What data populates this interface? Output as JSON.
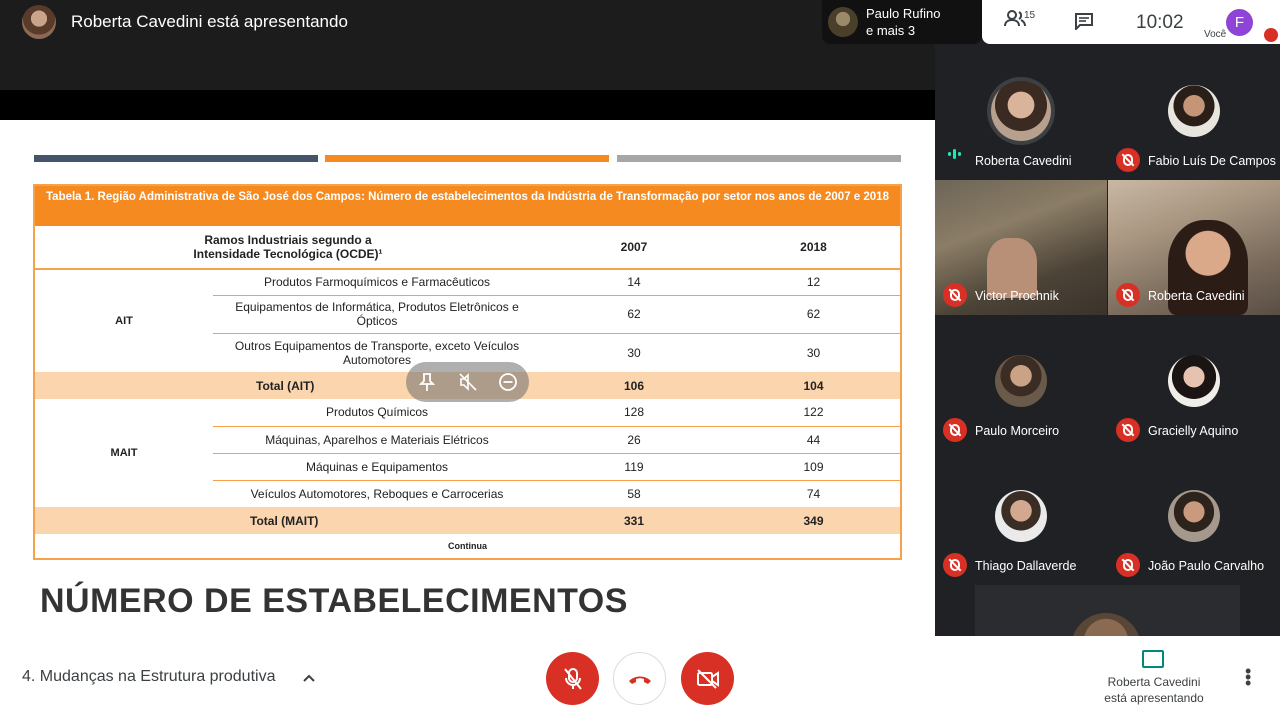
{
  "header": {
    "presenter_title": "Roberta Cavedini está apresentando",
    "extra_participants": {
      "line1": "Paulo Rufino",
      "line2": "e mais 3"
    },
    "people_count": "15",
    "clock": "10:02",
    "self_initial": "F",
    "self_label": "Você"
  },
  "slide": {
    "table_caption": "Tabela 1. Região Administrativa de São José dos Campos: Número de estabelecimentos da Indústria de Transformação por setor nos anos de 2007 e 2018",
    "col_header": "Ramos Industriais segundo a Intensidade Tecnológica (OCDE)¹",
    "year_1": "2007",
    "year_2": "2018",
    "groups": [
      {
        "name": "AIT",
        "rows": [
          {
            "label": "Produtos Farmoquímicos e Farmacêuticos",
            "v2007": "14",
            "v2018": "12"
          },
          {
            "label": "Equipamentos de Informática, Produtos Eletrônicos e Ópticos",
            "v2007": "62",
            "v2018": "62"
          },
          {
            "label": "Outros Equipamentos de Transporte, exceto Veículos Automotores",
            "v2007": "30",
            "v2018": "30"
          }
        ],
        "total": {
          "label": "Total (AIT)",
          "v2007": "106",
          "v2018": "104"
        }
      },
      {
        "name": "MAIT",
        "rows": [
          {
            "label": "Produtos Químicos",
            "v2007": "128",
            "v2018": "122"
          },
          {
            "label": "Máquinas, Aparelhos e Materiais Elétricos",
            "v2007": "26",
            "v2018": "44"
          },
          {
            "label": "Máquinas e Equipamentos",
            "v2007": "119",
            "v2018": "109"
          },
          {
            "label": "Veículos Automotores, Reboques e Carrocerias",
            "v2007": "58",
            "v2018": "74"
          }
        ],
        "total": {
          "label": "Total (MAIT)",
          "v2007": "331",
          "v2018": "349"
        }
      }
    ],
    "footer": "Continua",
    "heading": "NÚMERO DE ESTABELECIMENTOS"
  },
  "participants": [
    {
      "name": "Roberta Cavedini",
      "status": "speaking"
    },
    {
      "name": "Fabio Luís De Campos",
      "status": "muted"
    },
    {
      "name": "Victor Prochnik",
      "status": "muted"
    },
    {
      "name": "Roberta Cavedini",
      "status": "muted"
    },
    {
      "name": "Paulo Morceiro",
      "status": "muted"
    },
    {
      "name": "Gracielly Aquino",
      "status": "muted"
    },
    {
      "name": "Thiago Dallaverde",
      "status": "muted"
    },
    {
      "name": "João Paulo Carvalho",
      "status": "muted"
    }
  ],
  "bottom": {
    "meeting_title": "4. Mudanças na Estrutura produtiva",
    "presenting_line1": "Roberta Cavedini",
    "presenting_line2": "está apresentando"
  },
  "colors": {
    "accent_orange": "#f58a20",
    "mute_red": "#d93025",
    "present_green": "#00897b"
  }
}
